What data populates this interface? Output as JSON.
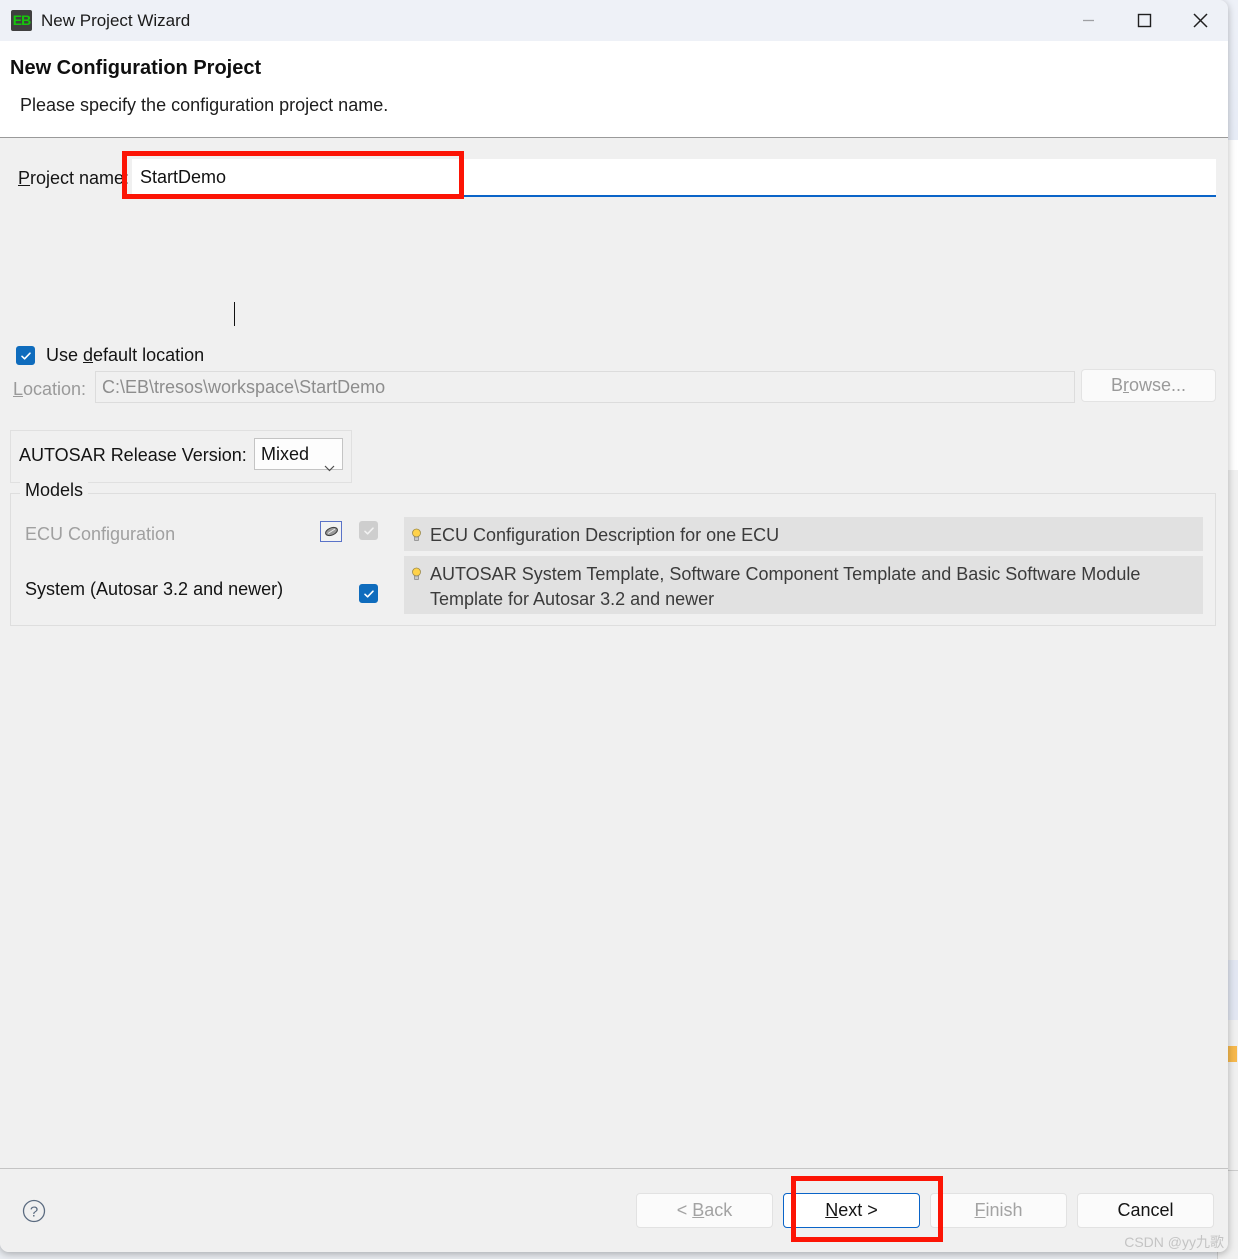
{
  "window": {
    "title": "New Project Wizard",
    "icon": "eb-logo-icon",
    "icon_text": "EB",
    "controls": {
      "minimize": "minimize-icon",
      "maximize": "maximize-icon",
      "close": "close-icon"
    }
  },
  "header": {
    "title": "New Configuration Project",
    "subtitle": "Please specify the configuration project name."
  },
  "form": {
    "project_name_label": "Project name:",
    "project_name_value": "StartDemo",
    "project_name_placeholder": "",
    "use_default_location_label": "Use default location",
    "use_default_location_checked": true,
    "location_label": "Location:",
    "location_value": "C:\\EB\\tresos\\workspace\\StartDemo",
    "browse_label": "Browse...",
    "browse_enabled": false
  },
  "autosar": {
    "label": "AUTOSAR Release Version:",
    "selected": "Mixed",
    "options": [
      "Mixed"
    ]
  },
  "models": {
    "legend": "Models",
    "rows": [
      {
        "name": "ECU Configuration",
        "checked": true,
        "enabled": false,
        "icon": "ecu-chip-icon",
        "description": "ECU Configuration Description for one ECU"
      },
      {
        "name": "System (Autosar 3.2 and newer)",
        "checked": true,
        "enabled": true,
        "icon": "",
        "description": "AUTOSAR System Template, Software Component Template and Basic Software Module Template for Autosar 3.2 and newer"
      }
    ]
  },
  "footer": {
    "help": "help-icon",
    "buttons": [
      {
        "label": "< Back",
        "enabled": false,
        "default": false,
        "name": "back-button"
      },
      {
        "label": "Next >",
        "enabled": true,
        "default": true,
        "name": "next-button"
      },
      {
        "label": "Finish",
        "enabled": false,
        "default": false,
        "name": "finish-button"
      },
      {
        "label": "Cancel",
        "enabled": true,
        "default": false,
        "name": "cancel-button"
      }
    ]
  },
  "annotations": {
    "highlight_color": "#fc1405",
    "boxes": [
      "project-name-field",
      "next-button"
    ]
  },
  "watermark": "CSDN @yy九歌"
}
